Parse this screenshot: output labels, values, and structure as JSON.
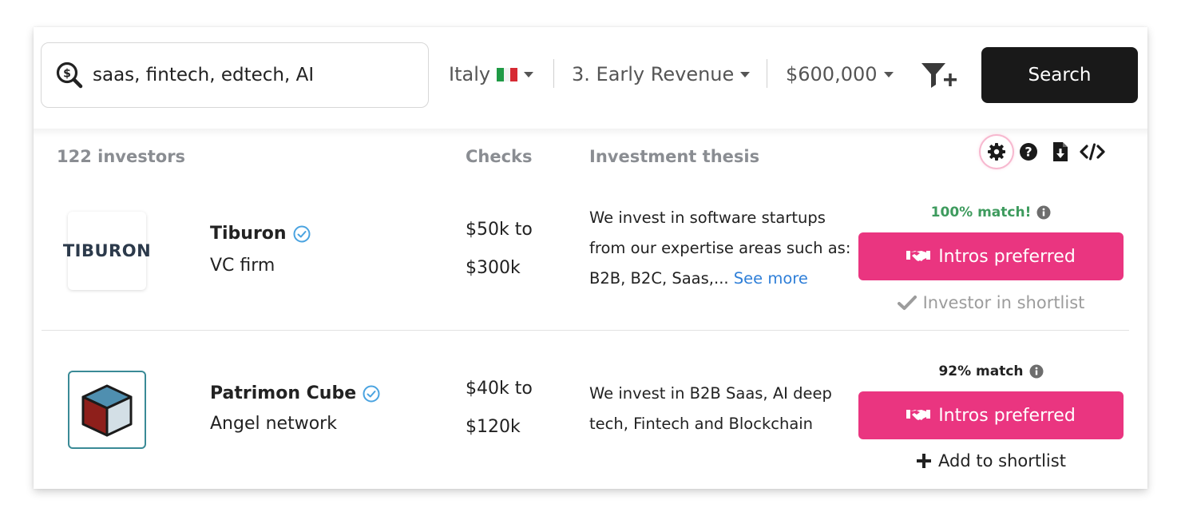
{
  "search": {
    "value": "saas, fintech, edtech, AI",
    "button_label": "Search"
  },
  "filters": {
    "country": "Italy",
    "stage": "3. Early Revenue",
    "amount": "$600,000"
  },
  "list_header": {
    "count": "122 investors",
    "checks": "Checks",
    "thesis": "Investment thesis"
  },
  "colors": {
    "accent_pink": "#ea3580",
    "match_green": "#3e9b5e",
    "link_blue": "#2f7fd8",
    "dark_button": "#191919"
  },
  "investors": [
    {
      "logo_text": "TIBURON",
      "name": "Tiburon",
      "type": "VC firm",
      "checks_from": "$50k to",
      "checks_to": "$300k",
      "thesis": "We invest in software startups from our expertise areas such as: B2B, B2C, Saas,...",
      "see_more": "See more",
      "match": "100% match!",
      "intros_label": "Intros preferred",
      "shortlist_label": "Investor in shortlist"
    },
    {
      "logo_icon": "cube-logo",
      "name": "Patrimon Cube",
      "type": "Angel network",
      "checks_from": "$40k to",
      "checks_to": "$120k",
      "thesis": "We invest in B2B Saas, AI deep tech, Fintech and Blockchain",
      "match": "92% match",
      "intros_label": "Intros preferred",
      "shortlist_label": "Add to shortlist"
    }
  ],
  "icons": [
    "dollar-search-icon",
    "chevron-down-icon",
    "filter-plus-icon",
    "gear-icon",
    "question-icon",
    "download-icon",
    "code-icon",
    "verified-icon",
    "info-icon",
    "handshake-icon",
    "check-icon",
    "plus-icon"
  ]
}
